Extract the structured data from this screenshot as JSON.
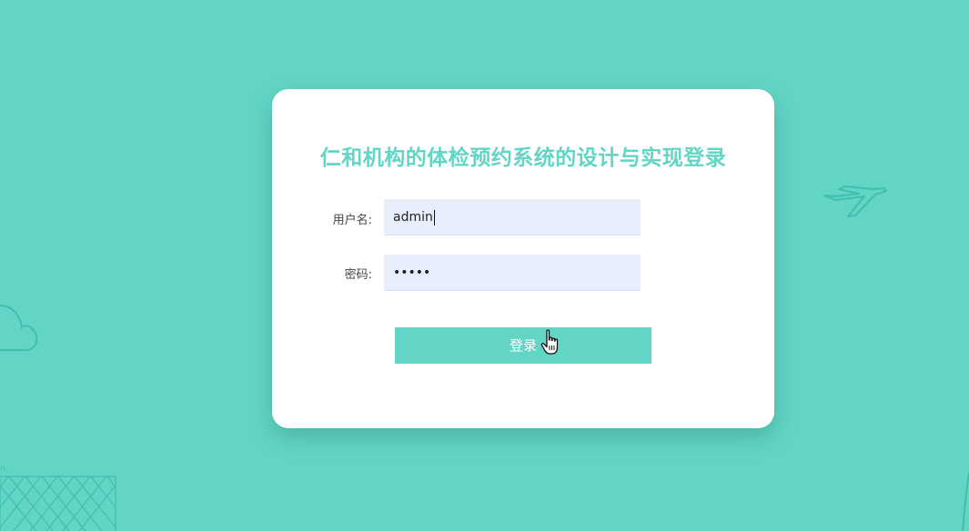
{
  "login": {
    "title": "仁和机构的体检预约系统的设计与实现登录",
    "username_label": "用户名:",
    "username_value": "admin",
    "password_label": "密码:",
    "password_masked": "•••••",
    "submit_label": "登录"
  },
  "theme": {
    "accent": "#62d5c5",
    "background": "#62d5c5",
    "card": "#ffffff",
    "input_bg": "#e8eefb"
  },
  "icons": [
    "airplane-icon",
    "cloud-icon",
    "hand-pointer-cursor-icon"
  ]
}
